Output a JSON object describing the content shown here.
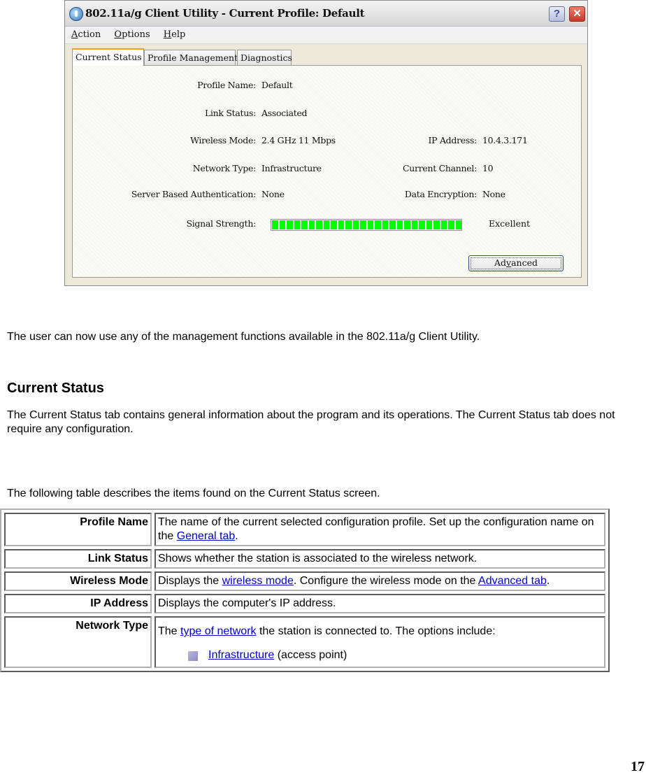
{
  "dialog": {
    "title": "802.11a/g Client Utility - Current Profile: Default",
    "help_button": "?",
    "close_button": "✕",
    "menu": [
      {
        "label": "Action",
        "mnemonic": "A",
        "rest": "ction"
      },
      {
        "label": "Options",
        "mnemonic": "O",
        "rest": "ptions"
      },
      {
        "label": "Help",
        "mnemonic": "H",
        "rest": "elp"
      }
    ],
    "tabs": [
      {
        "label": "Current Status",
        "active": true
      },
      {
        "label": "Profile Management",
        "active": false
      },
      {
        "label": "Diagnostics",
        "active": false
      }
    ],
    "fields": {
      "profile_name": {
        "label": "Profile Name:",
        "value": "Default"
      },
      "link_status": {
        "label": "Link Status:",
        "value": "Associated"
      },
      "wireless_mode": {
        "label": "Wireless Mode:",
        "value": "2.4 GHz 11 Mbps"
      },
      "ip_address": {
        "label": "IP Address:",
        "value": "10.4.3.171"
      },
      "network_type": {
        "label": "Network Type:",
        "value": "Infrastructure"
      },
      "current_channel": {
        "label": "Current Channel:",
        "value": "10"
      },
      "server_auth": {
        "label": "Server Based Authentication:",
        "value": "None"
      },
      "data_encryption": {
        "label": "Data Encryption:",
        "value": "None"
      },
      "signal_strength": {
        "label": "Signal Strength:",
        "value_text": "Excellent",
        "level_percent": 100,
        "color": "#00ff00"
      }
    },
    "advanced_button": {
      "label_pre": "Ad",
      "mnemonic": "v",
      "label_post": "anced"
    }
  },
  "doc": {
    "intro": "The user can now use any of the management functions available in the 802.11a/g Client Utility.",
    "heading": "Current Status",
    "description": "The Current Status tab contains general information about the program and its operations. The Current Status tab does not require any configuration.",
    "table_intro": "The following table describes the items found on the Current Status screen.",
    "link_color": "#0000cc",
    "table": [
      {
        "term": "Profile Name",
        "text_before": "The name of the current selected configuration profile.   Set up the configuration name on the ",
        "link": "General tab",
        "text_after": "."
      },
      {
        "term": "Link Status",
        "text": "Shows whether the station is associated to the wireless network."
      },
      {
        "term": "Wireless Mode",
        "text_before": "Displays the ",
        "link": "wireless mode",
        "text_mid": ".   Configure the wireless mode on the ",
        "link2": "Advanced tab",
        "text_after": "."
      },
      {
        "term": "IP Address",
        "text": "Displays the computer's IP address."
      },
      {
        "term": "Network Type",
        "text_before": "The ",
        "link": "type of network",
        "text_after": " the station is connected to.   The options include:",
        "options": [
          {
            "link": "Infrastructure",
            "text": " (access point)"
          }
        ]
      }
    ],
    "page_number": "17"
  }
}
